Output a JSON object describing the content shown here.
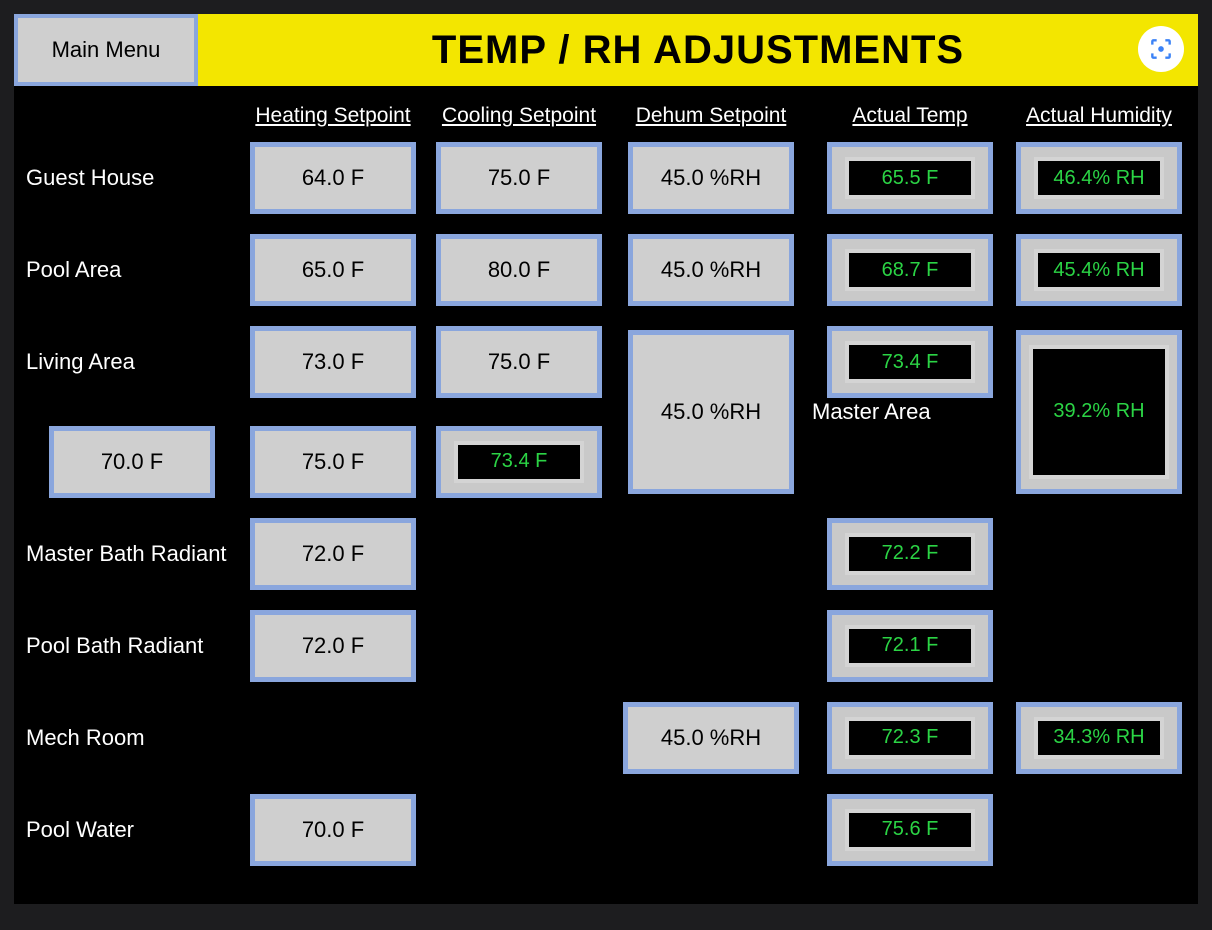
{
  "header": {
    "main_menu": "Main Menu",
    "title": "TEMP / RH ADJUSTMENTS"
  },
  "columns": {
    "heating": "Heating Setpoint",
    "cooling": "Cooling Setpoint",
    "dehum": "Dehum Setpoint",
    "actual_temp": "Actual Temp",
    "actual_humidity": "Actual Humidity"
  },
  "rows": {
    "guest_house": {
      "label": "Guest House",
      "heating": "64.0 F",
      "cooling": "75.0 F",
      "dehum": "45.0 %RH",
      "temp": "65.5 F",
      "rh": "46.4% RH"
    },
    "pool_area": {
      "label": "Pool Area",
      "heating": "65.0 F",
      "cooling": "80.0 F",
      "dehum": "45.0 %RH",
      "temp": "68.7 F",
      "rh": "45.4% RH"
    },
    "living_area": {
      "label": "Living Area",
      "heating": "73.0 F",
      "cooling": "75.0 F",
      "temp": "73.4 F"
    },
    "master_area": {
      "label": "Master Area",
      "heating": "70.0 F",
      "cooling": "75.0 F",
      "temp": "73.4 F"
    },
    "living_master_shared": {
      "dehum": "45.0 %RH",
      "rh": "39.2% RH"
    },
    "master_bath": {
      "label": "Master Bath Radiant",
      "heating": "72.0 F",
      "temp": "72.2 F"
    },
    "pool_bath": {
      "label": "Pool Bath Radiant",
      "heating": "72.0 F",
      "temp": "72.1 F"
    },
    "mech_room": {
      "label": "Mech Room",
      "dehum": "45.0 %RH",
      "temp": "72.3 F",
      "rh": "34.3% RH"
    },
    "pool_water": {
      "label": "Pool Water",
      "heating": "70.0 F",
      "temp": "75.6 F"
    }
  }
}
